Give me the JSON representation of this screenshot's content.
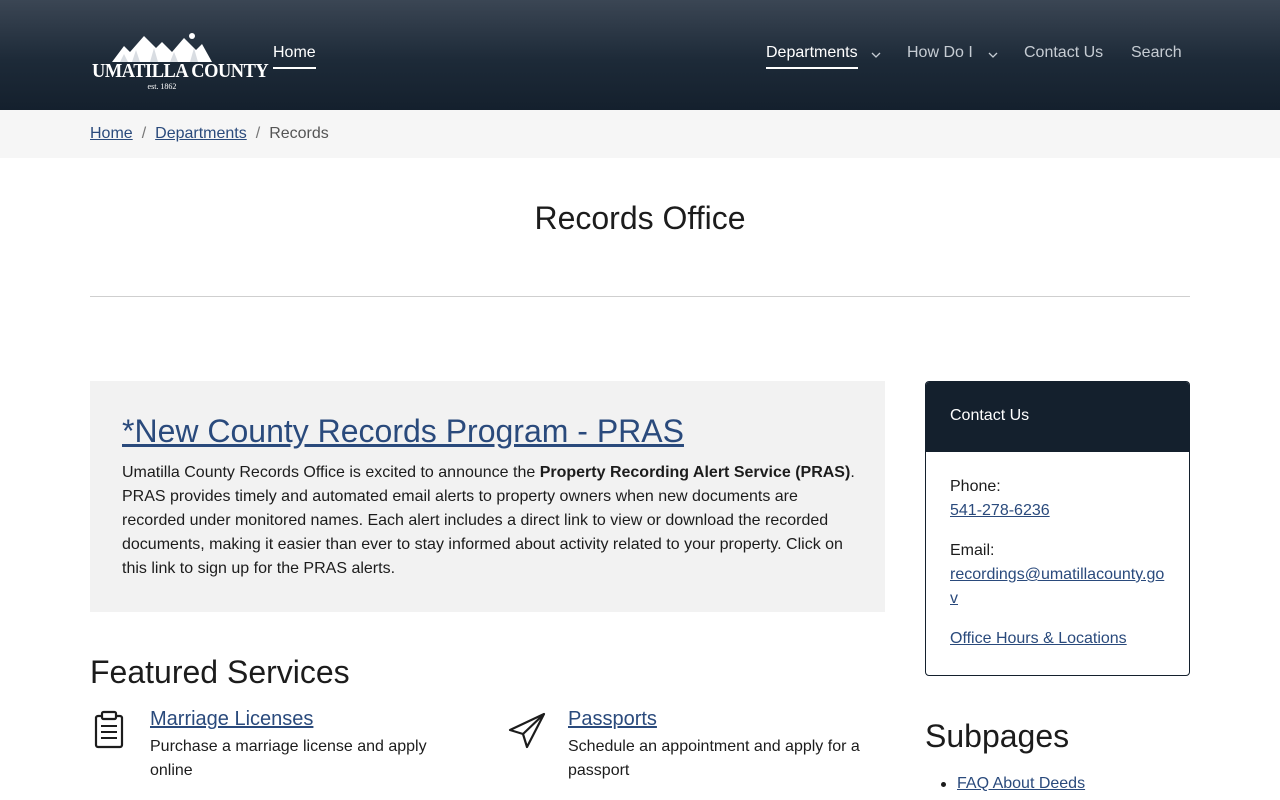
{
  "header": {
    "logo_text": "UMATILLA COUNTY",
    "logo_est": "est. 1862",
    "nav_home": "Home",
    "nav": [
      {
        "label": "Departments"
      },
      {
        "label": "How Do I"
      },
      {
        "label": "Contact Us"
      },
      {
        "label": "Search"
      }
    ]
  },
  "breadcrumb": {
    "home": "Home",
    "departments": "Departments",
    "current": "Records",
    "separator": "/"
  },
  "page": {
    "title": "Records Office"
  },
  "announcement": {
    "title": "*New County Records Program - PRAS",
    "text_1": "Umatilla County Records Office is excited to announce the ",
    "bold": "Property Recording Alert Service (PRAS)",
    "text_2": ". PRAS provides timely and automated email alerts to property owners when new documents are recorded under monitored names. Each alert includes a direct link to view or download the recorded documents, making it easier than ever to stay informed about activity related to your property. Click on this link to sign up for the PRAS alerts."
  },
  "featured": {
    "title": "Featured Services",
    "services": [
      {
        "name": "Marriage Licenses",
        "desc": "Purchase a marriage license and apply online",
        "icon": "clipboard-icon"
      },
      {
        "name": "Passports",
        "desc": "Schedule an appointment and apply for a passport",
        "icon": "paper-plane-icon"
      }
    ]
  },
  "contact": {
    "title": "Contact Us",
    "phone_label": "Phone:",
    "phone": "541-278-6236",
    "email_label": "Email:",
    "email": "recordings@umatillacounty.gov",
    "hours_link": "Office Hours & Locations"
  },
  "subpages": {
    "title": "Subpages",
    "items": [
      "FAQ About Deeds"
    ]
  },
  "colors": {
    "header_dark": "#14202d",
    "link": "#2a4a7c",
    "panel_bg": "#f2f2f2"
  }
}
